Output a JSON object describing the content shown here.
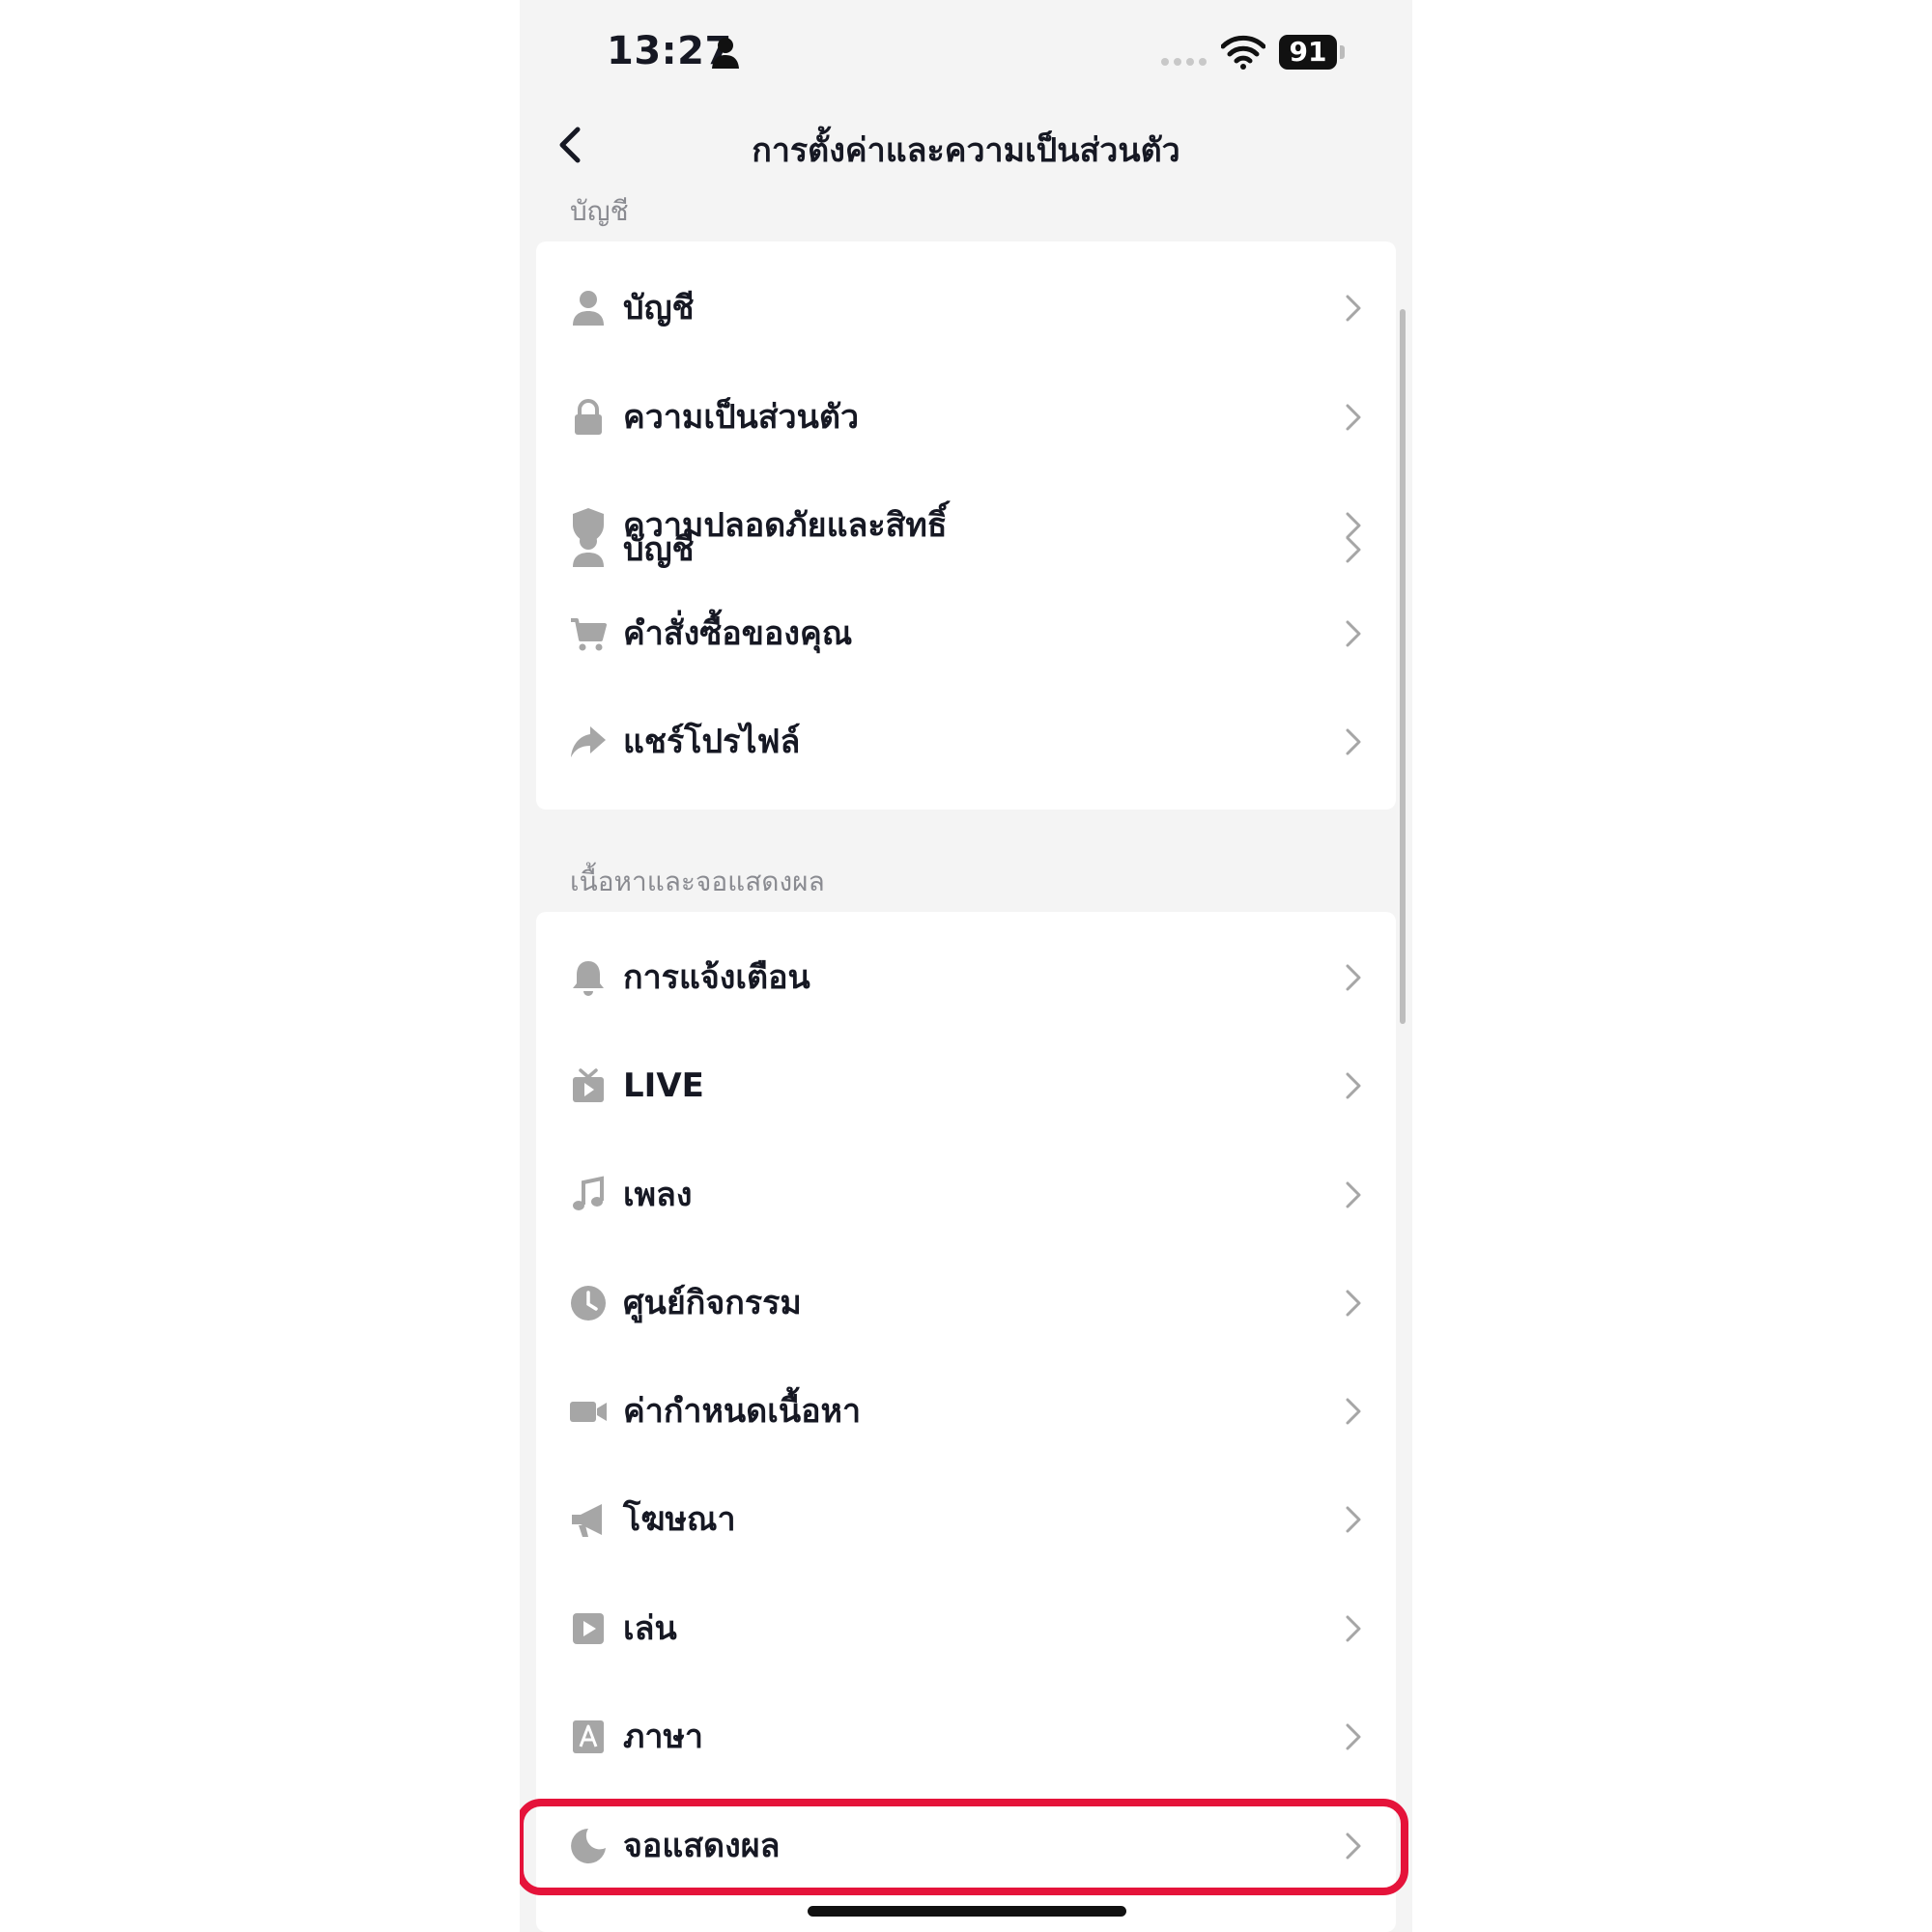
{
  "status_bar": {
    "time": "13:27",
    "battery": "91"
  },
  "nav": {
    "title": "การตั้งค่าและความเป็นส่วนตัว"
  },
  "sections": [
    {
      "label": "บัญชี",
      "items": [
        {
          "label": "บัญชี",
          "icon": "person-icon"
        },
        {
          "label": "ความเป็นส่วนตัว",
          "icon": "lock-icon"
        },
        {
          "label": "ความปลอดภัยและสิทธิ์",
          "icon": "shield-icon"
        },
        {
          "label": "คำสั่งซื้อของคุณ",
          "icon": "cart-icon"
        },
        {
          "label": "แชร์โปรไฟล์",
          "icon": "share-icon"
        }
      ]
    },
    {
      "label": "เนื้อหาและจอแสดงผล",
      "items": [
        {
          "label": "การแจ้งเตือน",
          "icon": "bell-icon"
        },
        {
          "label": "LIVE",
          "icon": "live-tv-icon"
        },
        {
          "label": "เพลง",
          "icon": "music-note-icon"
        },
        {
          "label": "ศูนย์กิจกรรม",
          "icon": "clock-icon"
        },
        {
          "label": "ค่ากำหนดเนื้อหา",
          "icon": "video-camera-icon"
        },
        {
          "label": "โฆษณา",
          "icon": "megaphone-icon"
        },
        {
          "label": "เล่น",
          "icon": "play-icon"
        },
        {
          "label": "ภาษา",
          "icon": "language-icon"
        },
        {
          "label": "จอแสดงผล",
          "icon": "moon-icon"
        }
      ]
    }
  ],
  "colors": {
    "highlight": "#e5133a",
    "icon": "#a6a6a6",
    "background": "#f4f4f4"
  }
}
